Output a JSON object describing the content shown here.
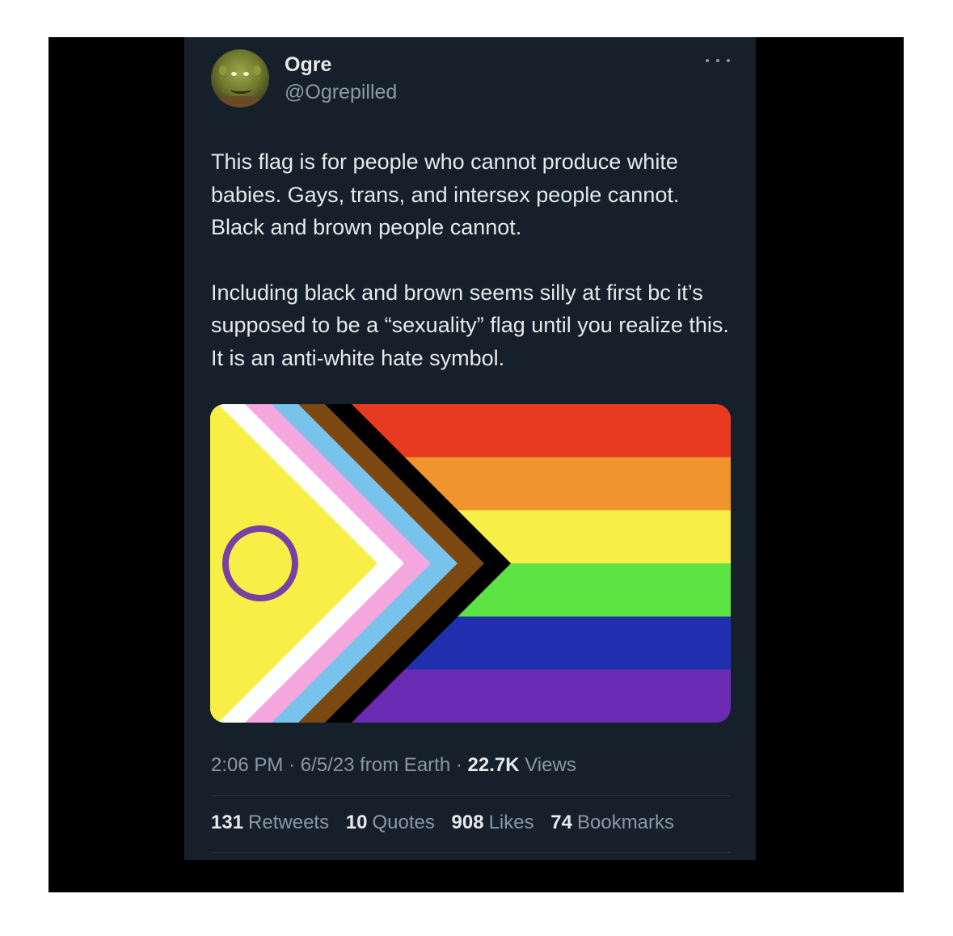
{
  "author": {
    "display_name": "Ogre",
    "handle": "@Ogrepilled"
  },
  "tweet": {
    "paragraphs": [
      "This flag is for people who cannot produce white babies. Gays, trans, and intersex people cannot. Black and brown people cannot.",
      "Including black and brown seems silly at first bc it’s supposed to be a “sexuality” flag until you realize this. It is an anti-white hate symbol."
    ]
  },
  "meta": {
    "time": "2:06 PM",
    "date": "6/5/23",
    "source": "from Earth",
    "sep": "·",
    "views_count": "22.7K",
    "views_label": "Views"
  },
  "stats": [
    {
      "count": "131",
      "label": "Retweets"
    },
    {
      "count": "10",
      "label": "Quotes"
    },
    {
      "count": "908",
      "label": "Likes"
    },
    {
      "count": "74",
      "label": "Bookmarks"
    }
  ],
  "colors": {
    "frame": "#000000",
    "card": "#15202b",
    "text": "#e7e9ea",
    "muted": "#8b98a5",
    "flag_stripes": [
      "#e83a20",
      "#f0952e",
      "#f7ef45",
      "#5ee345",
      "#1f2fad",
      "#6a2ab2"
    ],
    "chevrons": [
      "#000000",
      "#7b4812",
      "#78c3ec",
      "#f4a8df",
      "#ffffff",
      "#f7ef45"
    ],
    "intersex_ring": "#7a3fa5"
  }
}
